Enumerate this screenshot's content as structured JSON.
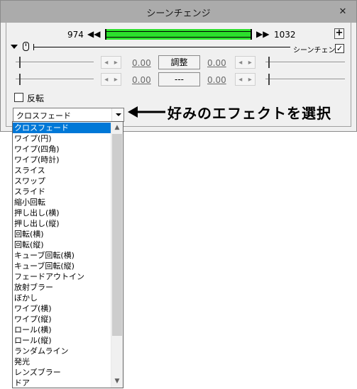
{
  "window": {
    "title": "シーンチェンジ",
    "close_label": "✕"
  },
  "frames": {
    "start": "974",
    "end": "1032",
    "prev_label": "◀◀",
    "next_label": "▶▶",
    "add_label": "+"
  },
  "timeline": {
    "scene_change_label": "シーンチェンジ",
    "scene_change_checked": "✓"
  },
  "tracks": [
    {
      "left_value": "0.00",
      "button_label": "調整",
      "right_value": "0.00"
    },
    {
      "left_value": "0.00",
      "button_label": "---",
      "right_value": "0.00"
    }
  ],
  "spin_labels": {
    "left": "◂",
    "right": "▸"
  },
  "flip": {
    "label": "反転",
    "checked": ""
  },
  "effect_select": {
    "selected": "クロスフェード",
    "options": [
      "クロスフェード",
      "ワイプ(円)",
      "ワイプ(四角)",
      "ワイプ(時計)",
      "スライス",
      "スワップ",
      "スライド",
      "縮小回転",
      "押し出し(横)",
      "押し出し(縦)",
      "回転(横)",
      "回転(縦)",
      "キューブ回転(横)",
      "キューブ回転(縦)",
      "フェードアウトイン",
      "放射ブラー",
      "ぼかし",
      "ワイプ(横)",
      "ワイプ(縦)",
      "ロール(横)",
      "ロール(縦)",
      "ランダムライン",
      "発光",
      "レンズブラー",
      "ドア"
    ],
    "scroll_up": "▲",
    "scroll_down": "▼"
  },
  "annotation": {
    "text": "好みのエフェクトを選択"
  },
  "colors": {
    "seek_bar": "#2ce02c",
    "selection": "#0078d7",
    "titlebar": "#ababab"
  }
}
